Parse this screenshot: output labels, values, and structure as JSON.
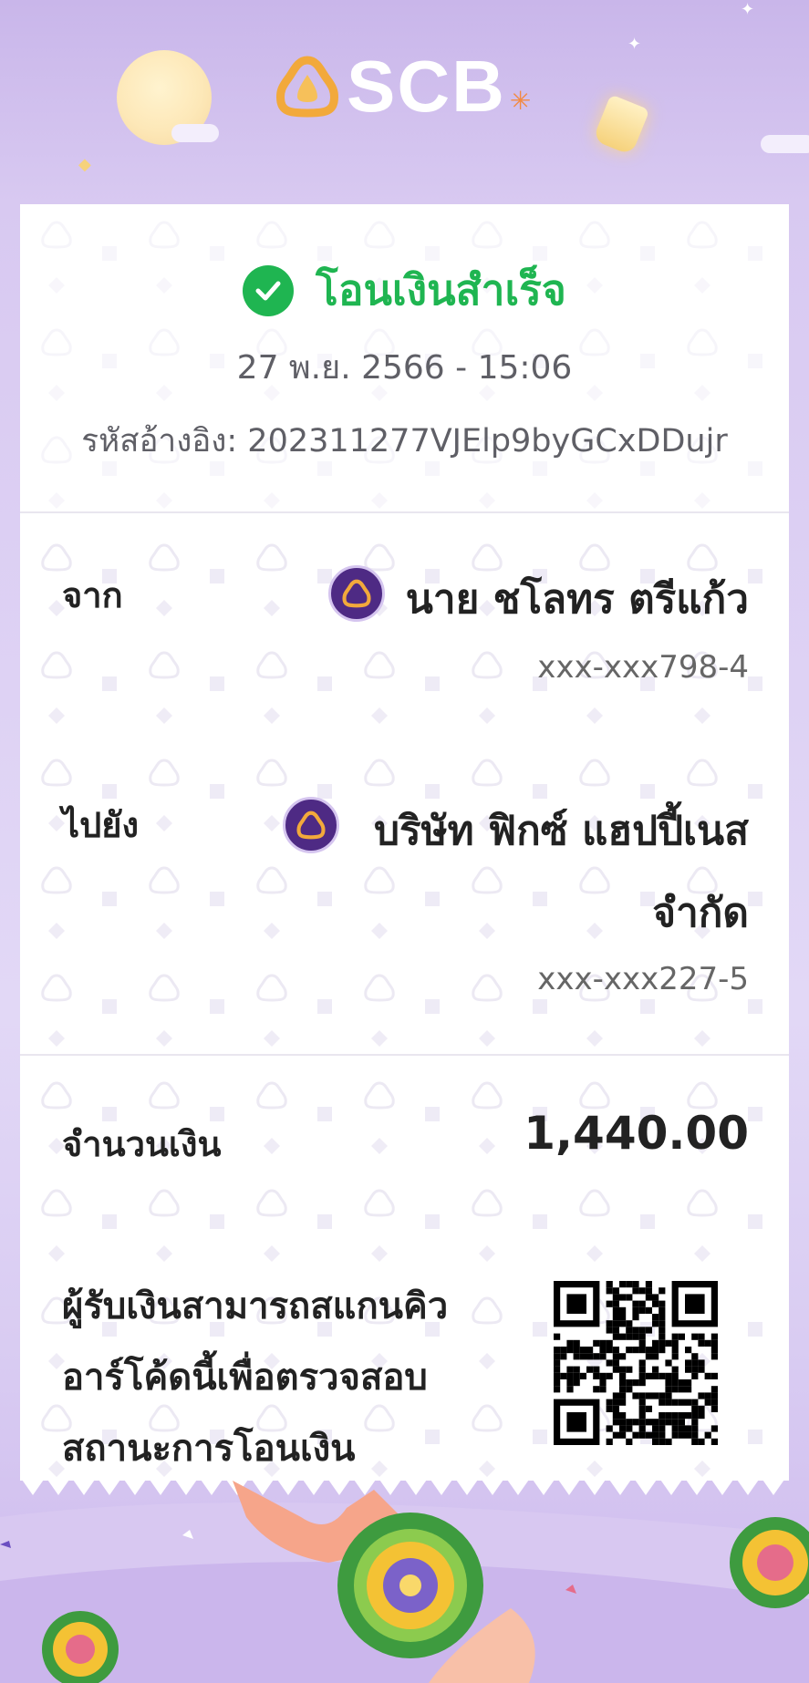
{
  "brand": {
    "name": "SCB"
  },
  "status": {
    "text": "โอนเงินสำเร็จ"
  },
  "transaction": {
    "datetime": "27 พ.ย. 2566 - 15:06",
    "reference": "รหัสอ้างอิง: 202311277VJElp9byGCxDDujr"
  },
  "from": {
    "label": "จาก",
    "name": "นาย ชโลทร ตรีแก้ว",
    "account": "xxx-xxx798-4"
  },
  "to": {
    "label": "ไปยัง",
    "name_line1": "บริษัท ฟิกซ์ แฮปปี้เนส",
    "name_line2": "จำกัด",
    "account": "xxx-xxx227-5"
  },
  "amount": {
    "label": "จำนวนเงิน",
    "value": "1,440.00"
  },
  "qr": {
    "note_line1": "ผู้รับเงินสามารถสแกนคิว",
    "note_line2": "อาร์โค้ดนี้เพื่อตรวจสอบ",
    "note_line3": "สถานะการโอนเงิน"
  },
  "colors": {
    "success": "#1fb551",
    "bank_purple": "#4e2a84",
    "logo_orange": "#f2a93b"
  },
  "icons": [
    "scb-logo-icon",
    "success-check-icon",
    "bank-icon",
    "qr-code"
  ]
}
